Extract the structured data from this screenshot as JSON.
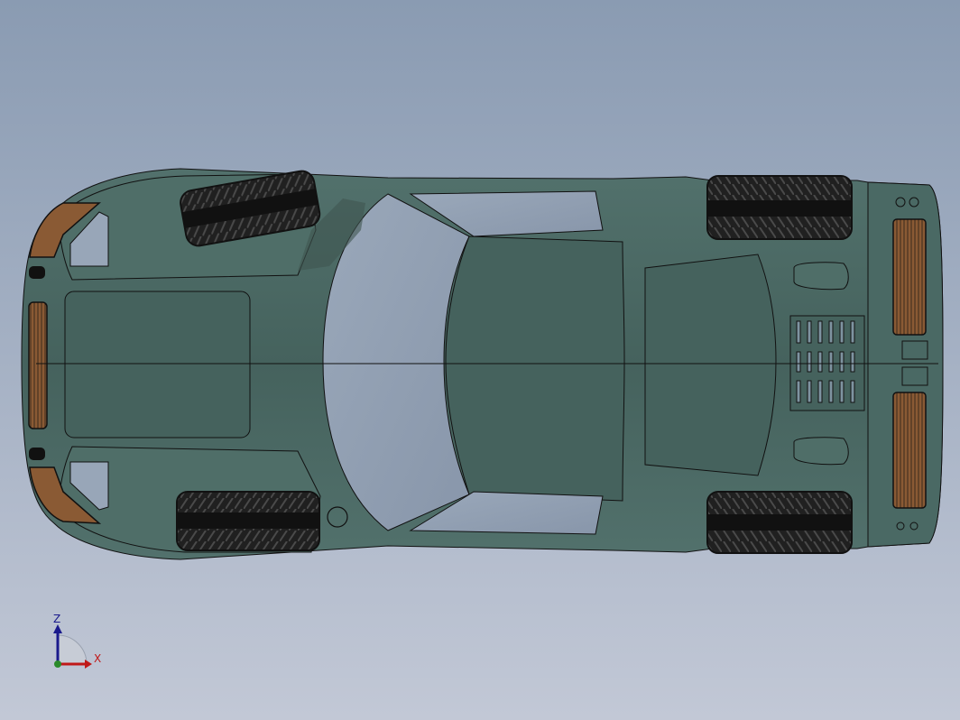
{
  "viewport": {
    "background_top": "#8a9bb2",
    "background_bottom": "#c2c8d6",
    "body_color": "#45625d",
    "body_light": "#5a7a74",
    "glass_color": "#98a6b8",
    "tire_color": "#1b1b1b",
    "light_color": "#8a5a34"
  },
  "triad": {
    "z_label": "Z",
    "x_label": "X",
    "z_color": "#1a1a8c",
    "x_color": "#c01818"
  }
}
